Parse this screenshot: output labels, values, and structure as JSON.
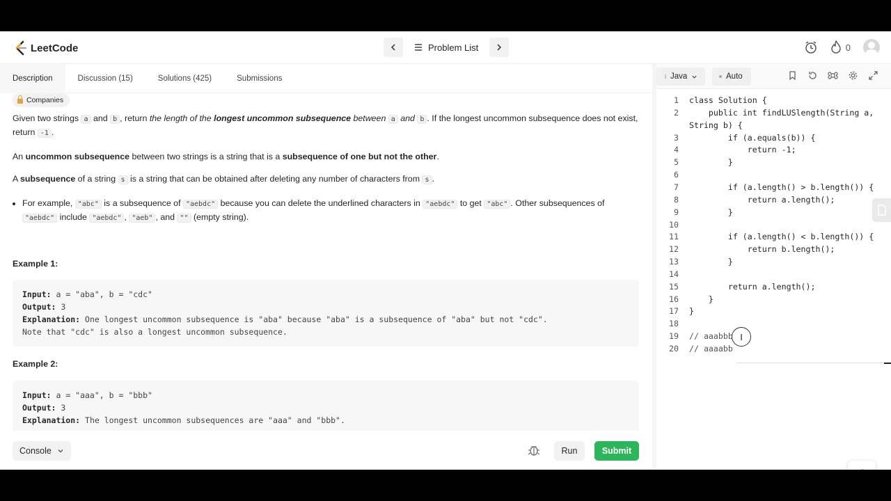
{
  "nav": {
    "logo_text": "LeetCode",
    "problem_list": "Problem List",
    "streak_count": "0"
  },
  "tabs": [
    {
      "label": "Description",
      "active": true
    },
    {
      "label": "Discussion (15)",
      "active": false
    },
    {
      "label": "Solutions (425)",
      "active": false
    },
    {
      "label": "Submissions",
      "active": false
    }
  ],
  "description": {
    "companies": "Companies",
    "p1": {
      "t1": "Given two strings ",
      "c1": "a",
      "t2": " and ",
      "c2": "b",
      "t3": ", return ",
      "i1": "the length of the ",
      "b1": "longest uncommon subsequence",
      "i2": " between ",
      "c3": "a",
      "i3": " and ",
      "c4": "b",
      "t4": ". If the longest uncommon subsequence does not exist, return ",
      "c5": "-1",
      "t5": "."
    },
    "p2": {
      "t1": "An ",
      "b1": "uncommon subsequence",
      "t2": " between two strings is a string that is a ",
      "b2": "subsequence of one but not the other",
      "t3": "."
    },
    "p3": {
      "t1": "A ",
      "b1": "subsequence",
      "t2": " of a string ",
      "c1": "s",
      "t3": " is a string that can be obtained after deleting any number of characters from ",
      "c2": "s",
      "t4": "."
    },
    "bullet": {
      "t1": "For example, ",
      "c1": "\"abc\"",
      "t2": " is a subsequence of ",
      "c2": "\"aebdc\"",
      "t3": " because you can delete the underlined characters in ",
      "c3": "\"aebdc\"",
      "t4": " to get ",
      "c4": "\"abc\"",
      "t5": ". Other subsequences of ",
      "c5": "\"aebdc\"",
      "t6": " include ",
      "c6": "\"aebdc\"",
      "t7": ", ",
      "c7": "\"aeb\"",
      "t8": ", and ",
      "c8": "\"\"",
      "t9": " (empty string)."
    },
    "example1": {
      "title": "Example 1:",
      "input_label": "Input:",
      "input": " a = \"aba\", b = \"cdc\"",
      "output_label": "Output:",
      "output": " 3",
      "expl_label": "Explanation:",
      "expl": " One longest uncommon subsequence is \"aba\" because \"aba\" is a subsequence of \"aba\" but not \"cdc\".",
      "expl2": "Note that \"cdc\" is also a longest uncommon subsequence."
    },
    "example2": {
      "title": "Example 2:",
      "input_label": "Input:",
      "input": " a = \"aaa\", b = \"bbb\"",
      "output_label": "Output:",
      "output": " 3",
      "expl_label": "Explanation:",
      "expl": " The longest uncommon subsequences are \"aaa\" and \"bbb\"."
    }
  },
  "bottom": {
    "console": "Console",
    "run": "Run",
    "submit": "Submit"
  },
  "editor": {
    "language": "Java",
    "auto": "Auto",
    "lines": [
      {
        "n": "1",
        "code": "class Solution {"
      },
      {
        "n": "2",
        "code": "    public int findLUSlength(String a,"
      },
      {
        "n": "",
        "code": "String b) {"
      },
      {
        "n": "3",
        "code": "        if (a.equals(b)) {"
      },
      {
        "n": "4",
        "code": "            return -1;"
      },
      {
        "n": "5",
        "code": "        }"
      },
      {
        "n": "6",
        "code": ""
      },
      {
        "n": "7",
        "code": "        if (a.length() > b.length()) {"
      },
      {
        "n": "8",
        "code": "            return a.length();"
      },
      {
        "n": "9",
        "code": "        }"
      },
      {
        "n": "10",
        "code": ""
      },
      {
        "n": "11",
        "code": "        if (a.length() < b.length()) {"
      },
      {
        "n": "12",
        "code": "            return b.length();"
      },
      {
        "n": "13",
        "code": "        }"
      },
      {
        "n": "14",
        "code": ""
      },
      {
        "n": "15",
        "code": "        return a.length();"
      },
      {
        "n": "16",
        "code": "    }"
      },
      {
        "n": "17",
        "code": "}"
      },
      {
        "n": "18",
        "code": ""
      },
      {
        "n": "19",
        "code": "// aaabbb"
      },
      {
        "n": "20",
        "code": "// aaaabb"
      }
    ]
  },
  "icons": {
    "logo": "leetcode-logo-icon",
    "prev": "chevron-left-icon",
    "list": "list-icon",
    "next": "chevron-right-icon",
    "timer": "alarm-clock-icon",
    "fire": "fire-icon",
    "avatar": "user-avatar-icon",
    "lock": "lock-icon",
    "bug": "bug-icon",
    "bookmark": "bookmark-icon",
    "reset": "reset-icon",
    "shortcut": "command-icon",
    "settings": "gear-icon",
    "fullscreen": "expand-icon",
    "chat": "chat-icon",
    "cursor": "text-cursor-icon"
  },
  "colors": {
    "submit": "#2db55d",
    "lock": "#e6a23c"
  }
}
